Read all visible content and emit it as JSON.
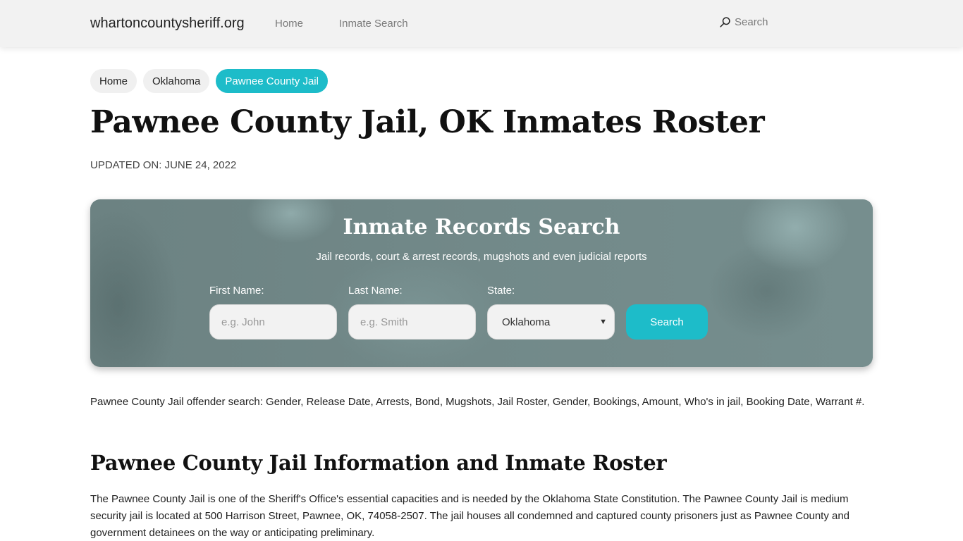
{
  "navbar": {
    "brand": "whartoncountysheriff.org",
    "links": [
      "Home",
      "Inmate Search"
    ],
    "search_label": "Search"
  },
  "breadcrumb": [
    "Home",
    "Oklahoma",
    "Pawnee County Jail"
  ],
  "page": {
    "title": "Pawnee County Jail, OK Inmates Roster",
    "updated": "UPDATED ON: JUNE 24, 2022"
  },
  "search_panel": {
    "title": "Inmate Records Search",
    "subtitle": "Jail records, court & arrest records, mugshots and even judicial reports",
    "first_name_label": "First Name:",
    "first_name_placeholder": "e.g. John",
    "last_name_label": "Last Name:",
    "last_name_placeholder": "e.g. Smith",
    "state_label": "State:",
    "state_value": "Oklahoma",
    "button_label": "Search"
  },
  "content": {
    "intro": "Pawnee County Jail offender search: Gender, Release Date, Arrests, Bond, Mugshots, Jail Roster, Gender, Bookings, Amount, Who's in jail, Booking Date, Warrant #.",
    "section_heading": "Pawnee County Jail Information and Inmate Roster",
    "section_text": "The Pawnee County Jail is one of the Sheriff's Office's essential capacities and is needed by the Oklahoma State Constitution. The Pawnee County Jail is medium security jail is located at 500 Harrison Street, Pawnee, OK, 74058-2507. The jail houses all condemned and captured county prisoners just as Pawnee County and government detainees on the way or anticipating preliminary."
  },
  "colors": {
    "accent": "#1dbcc9",
    "navbar_bg": "#f2f2f2",
    "panel_bg": "#728989"
  }
}
